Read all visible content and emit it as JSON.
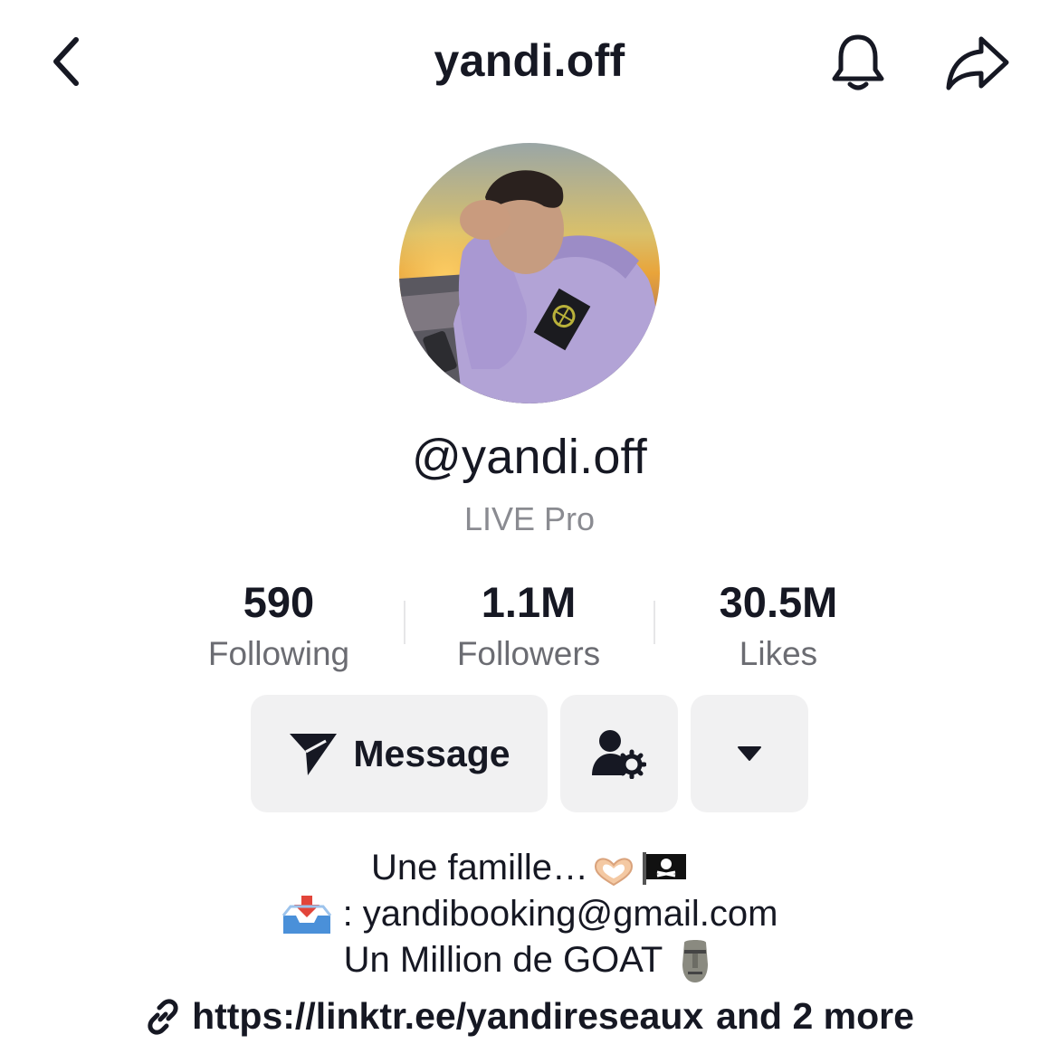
{
  "header": {
    "title": "yandi.off",
    "back_icon": "chevron-left-icon",
    "bell_icon": "bell-icon",
    "share_icon": "share-arrow-icon"
  },
  "profile": {
    "handle": "@yandi.off",
    "subtitle": "LIVE Pro"
  },
  "stats": [
    {
      "value": "590",
      "label": "Following"
    },
    {
      "value": "1.1M",
      "label": "Followers"
    },
    {
      "value": "30.5M",
      "label": "Likes"
    }
  ],
  "actions": {
    "message_label": "Message",
    "message_icon": "send-icon",
    "friend_icon": "user-settings-icon",
    "more_icon": "caret-down-icon"
  },
  "bio": {
    "line1": "Une famille…",
    "line1_emojis": [
      "heart-hands-emoji",
      "pirate-flag-emoji"
    ],
    "line2_icon": "inbox-tray-emoji",
    "line2": ": yandibooking@gmail.com",
    "line3": "Un Million de GOAT",
    "line3_emoji": "moai-emoji"
  },
  "link": {
    "url": "https://linktr.ee/yandireseaux",
    "suffix": "and 2 more",
    "icon": "link-icon"
  },
  "colors": {
    "text": "#161823",
    "muted": "#8a8b91",
    "button_bg": "#f1f1f2"
  }
}
